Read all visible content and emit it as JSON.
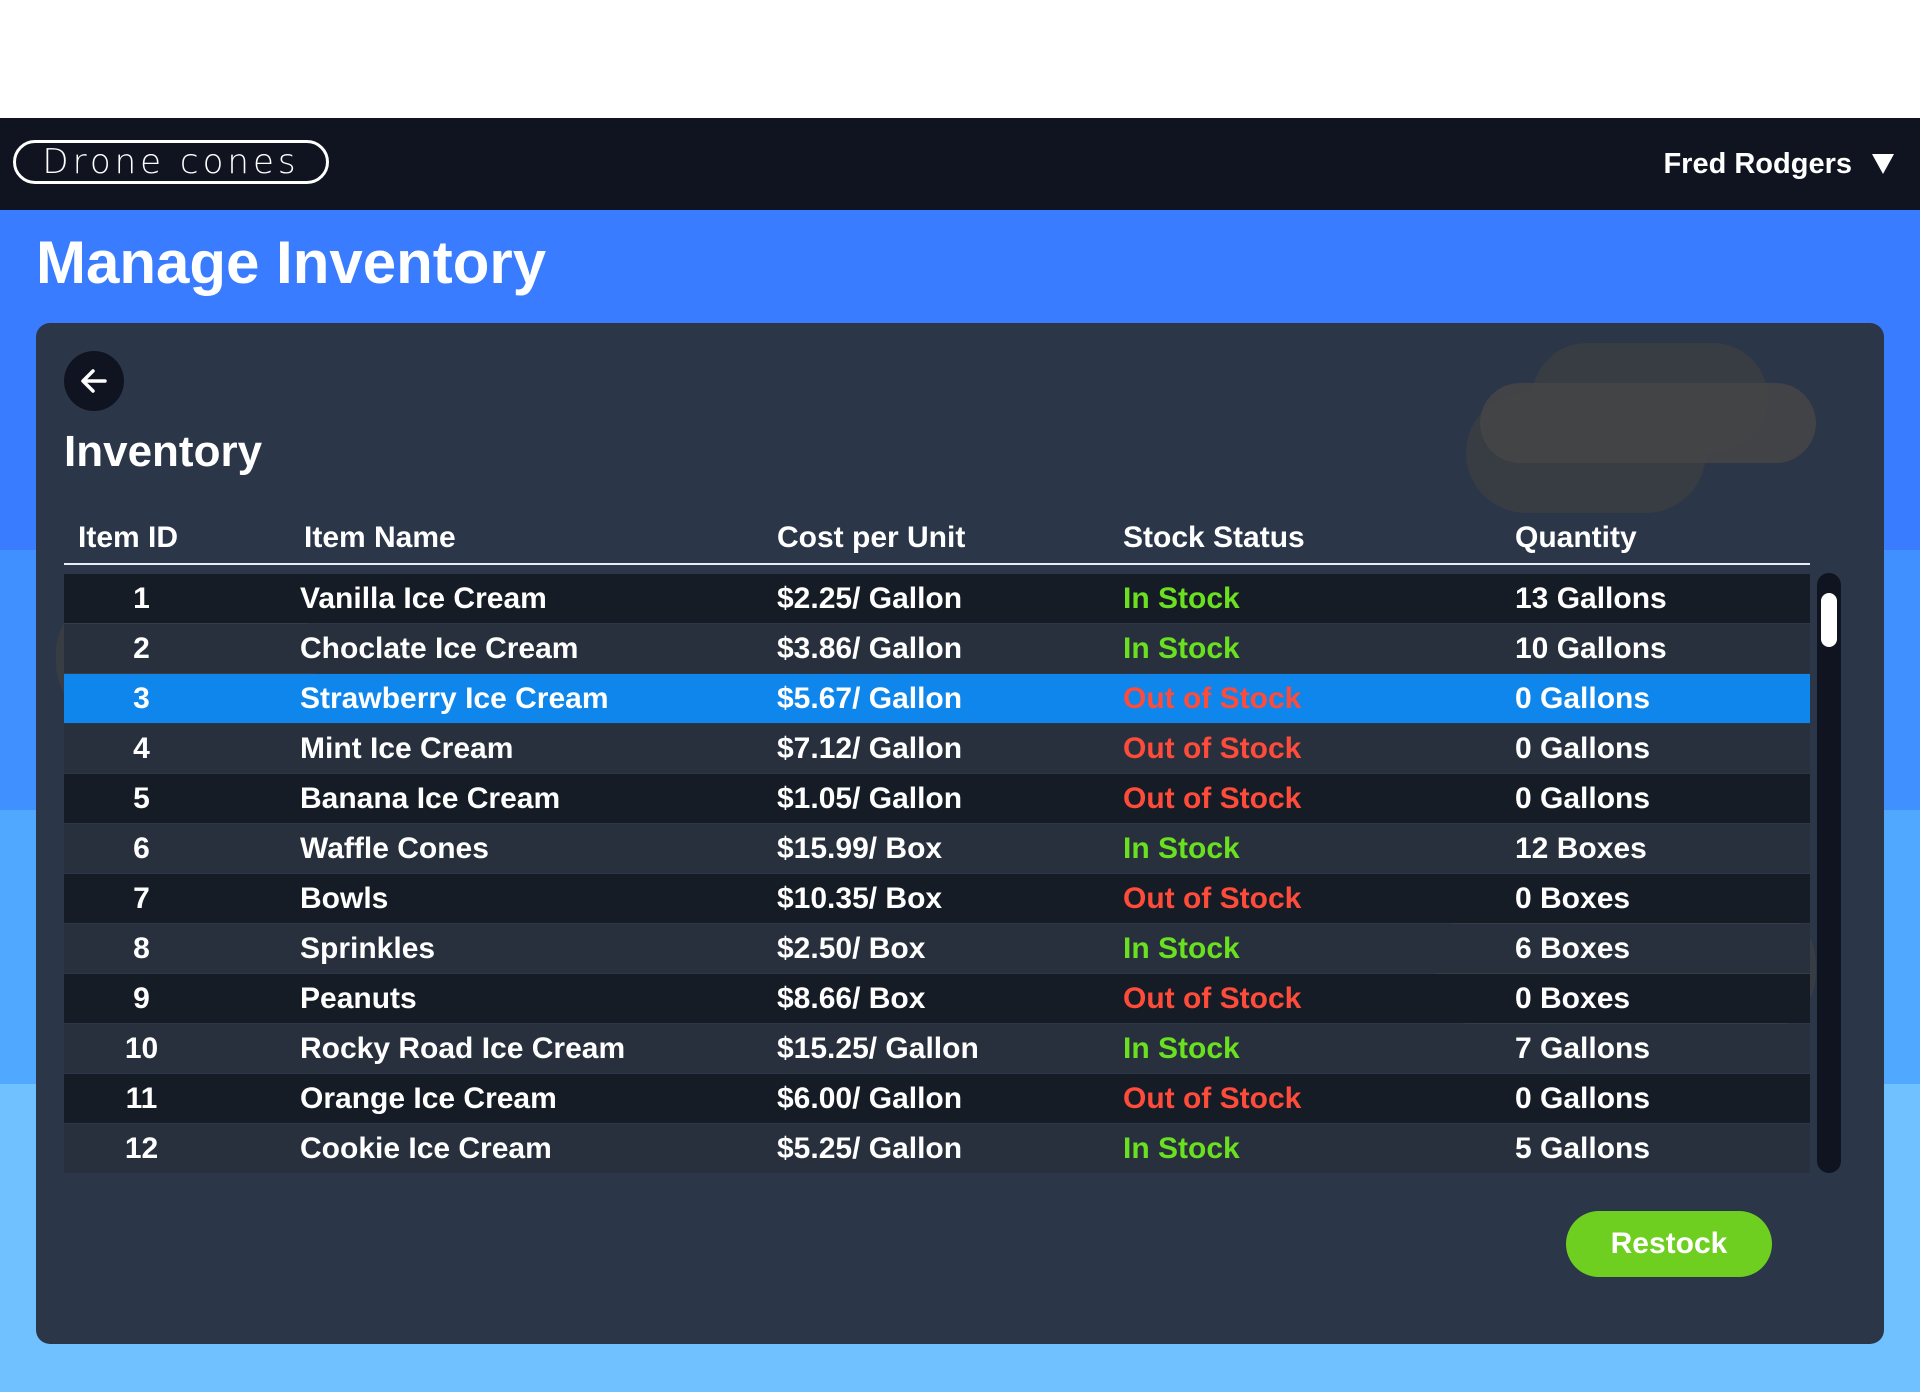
{
  "navbar": {
    "logo_text": "Drone cones",
    "user_name": "Fred Rodgers"
  },
  "page": {
    "title": "Manage Inventory"
  },
  "panel": {
    "section_title": "Inventory",
    "columns": [
      "Item ID",
      "Item Name",
      "Cost per Unit",
      "Stock Status",
      "Quantity"
    ],
    "rows": [
      {
        "id": "1",
        "name": "Vanilla Ice Cream",
        "cost": "$2.25/ Gallon",
        "status": "In Stock",
        "qty": "13 Gallons"
      },
      {
        "id": "2",
        "name": "Choclate Ice Cream",
        "cost": "$3.86/ Gallon",
        "status": "In Stock",
        "qty": "10 Gallons"
      },
      {
        "id": "3",
        "name": "Strawberry Ice Cream",
        "cost": "$5.67/ Gallon",
        "status": "Out of Stock",
        "qty": "0 Gallons"
      },
      {
        "id": "4",
        "name": "Mint Ice Cream",
        "cost": "$7.12/ Gallon",
        "status": "Out of Stock",
        "qty": "0 Gallons"
      },
      {
        "id": "5",
        "name": "Banana Ice Cream",
        "cost": "$1.05/ Gallon",
        "status": "Out of Stock",
        "qty": "0 Gallons"
      },
      {
        "id": "6",
        "name": "Waffle Cones",
        "cost": "$15.99/ Box",
        "status": "In Stock",
        "qty": "12 Boxes"
      },
      {
        "id": "7",
        "name": "Bowls",
        "cost": "$10.35/ Box",
        "status": "Out of Stock",
        "qty": "0 Boxes"
      },
      {
        "id": "8",
        "name": "Sprinkles",
        "cost": "$2.50/ Box",
        "status": "In Stock",
        "qty": "6 Boxes"
      },
      {
        "id": "9",
        "name": "Peanuts",
        "cost": "$8.66/ Box",
        "status": "Out of Stock",
        "qty": "0 Boxes"
      },
      {
        "id": "10",
        "name": "Rocky Road Ice Cream",
        "cost": "$15.25/ Gallon",
        "status": "In Stock",
        "qty": "7 Gallons"
      },
      {
        "id": "11",
        "name": "Orange Ice Cream",
        "cost": "$6.00/ Gallon",
        "status": "Out of Stock",
        "qty": "0 Gallons"
      },
      {
        "id": "12",
        "name": "Cookie Ice Cream",
        "cost": "$5.25/ Gallon",
        "status": "In Stock",
        "qty": "5 Gallons"
      }
    ],
    "selected_row_id": "3",
    "restock_label": "Restock"
  },
  "colors": {
    "in_stock": "#6be020",
    "out_of_stock": "#ff4b3a",
    "selected_row": "#0e86eb",
    "restock_button": "#6fcf21"
  },
  "icons": {
    "back": "arrow-left-icon",
    "user_menu": "caret-down-icon"
  }
}
